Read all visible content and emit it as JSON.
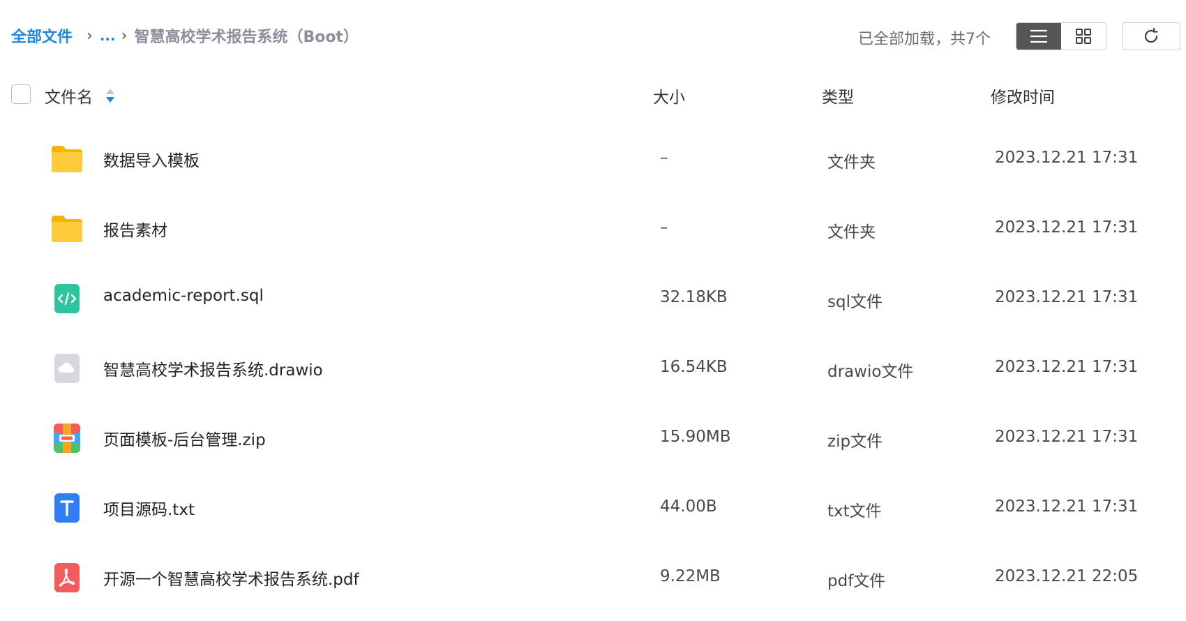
{
  "breadcrumb": {
    "root": "全部文件",
    "ellipsis": "...",
    "current": "智慧高校学术报告系统（Boot）"
  },
  "status": {
    "loaded": "已全部加载，共7个"
  },
  "toolbar": {
    "list_view": "list-view-icon",
    "grid_view": "grid-view-icon",
    "refresh": "refresh-icon"
  },
  "header": {
    "name": "文件名",
    "size": "大小",
    "type": "类型",
    "time": "修改时间"
  },
  "files": [
    {
      "name": "数据导入模板",
      "size": "–",
      "type": "文件夹",
      "time": "2023.12.21 17:31",
      "icon": "folder-icon"
    },
    {
      "name": "报告素材",
      "size": "–",
      "type": "文件夹",
      "time": "2023.12.21 17:31",
      "icon": "folder-icon"
    },
    {
      "name": "academic-report.sql",
      "size": "32.18KB",
      "type": "sql文件",
      "time": "2023.12.21 17:31",
      "icon": "code-file-icon"
    },
    {
      "name": "智慧高校学术报告系统.drawio",
      "size": "16.54KB",
      "type": "drawio文件",
      "time": "2023.12.21 17:31",
      "icon": "cloud-file-icon"
    },
    {
      "name": "页面模板-后台管理.zip",
      "size": "15.90MB",
      "type": "zip文件",
      "time": "2023.12.21 17:31",
      "icon": "archive-file-icon"
    },
    {
      "name": "项目源码.txt",
      "size": "44.00B",
      "type": "txt文件",
      "time": "2023.12.21 17:31",
      "icon": "text-file-icon"
    },
    {
      "name": "开源一个智慧高校学术报告系统.pdf",
      "size": "9.22MB",
      "type": "pdf文件",
      "time": "2023.12.21 22:05",
      "icon": "pdf-file-icon"
    }
  ],
  "colors": {
    "accent": "#1e88e5",
    "folder": "#ffc83d",
    "sql": "#2ec4a0",
    "pdf": "#f25c5c",
    "txt": "#2f7ef5"
  }
}
